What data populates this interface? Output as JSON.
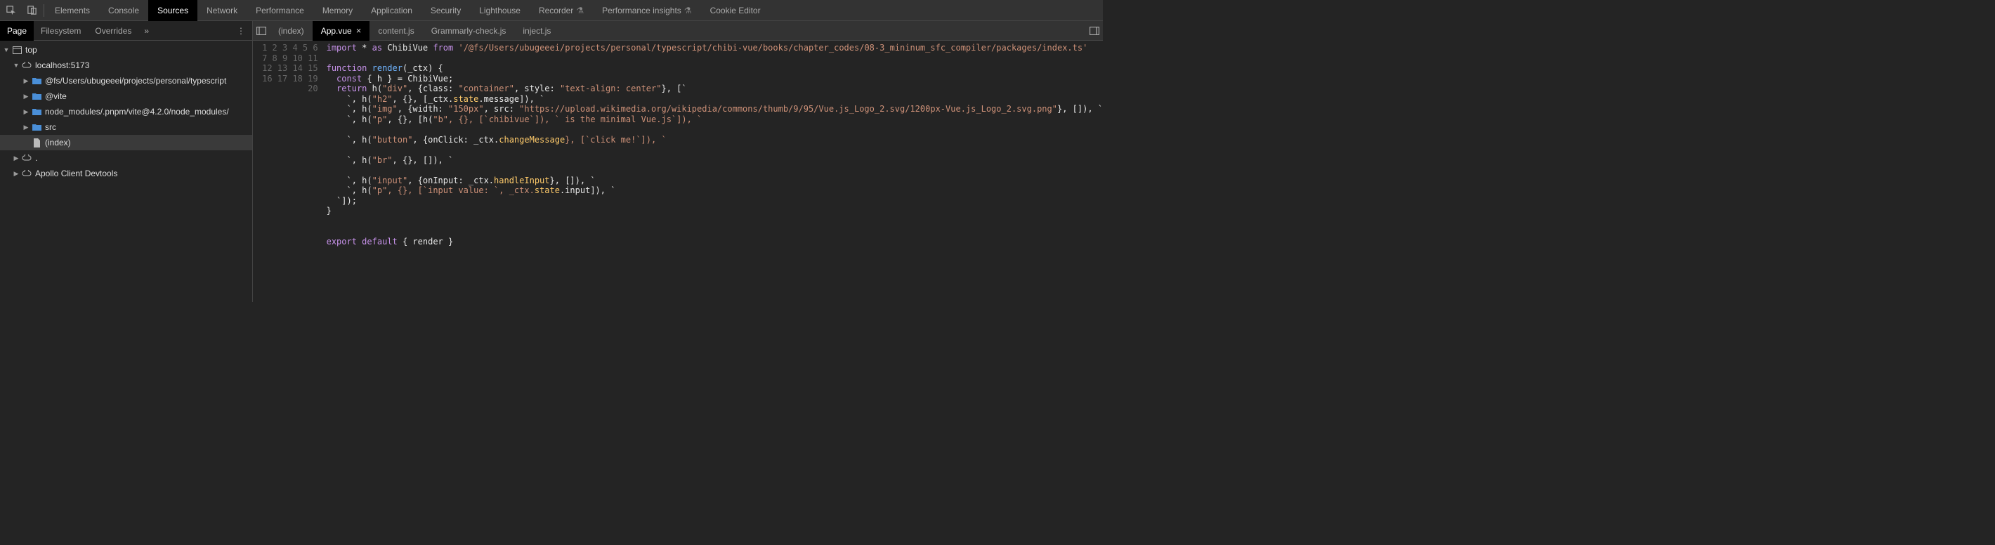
{
  "topTabs": {
    "elements": "Elements",
    "console": "Console",
    "sources": "Sources",
    "network": "Network",
    "performance": "Performance",
    "memory": "Memory",
    "application": "Application",
    "security": "Security",
    "lighthouse": "Lighthouse",
    "recorder": "Recorder",
    "perfInsights": "Performance insights",
    "cookieEditor": "Cookie Editor"
  },
  "subTabs": {
    "page": "Page",
    "filesystem": "Filesystem",
    "overrides": "Overrides"
  },
  "tree": {
    "top": "top",
    "localhost": "localhost:5173",
    "fs": "@fs/Users/ubugeeei/projects/personal/typescript",
    "vite": "@vite",
    "node_modules": "node_modules/.pnpm/vite@4.2.0/node_modules/",
    "src": "src",
    "index": "(index)",
    "dot": ".",
    "apollo": "Apollo Client Devtools"
  },
  "fileTabs": {
    "index": "(index)",
    "app": "App.vue",
    "content": "content.js",
    "grammarly": "Grammarly-check.js",
    "inject": "inject.js"
  },
  "code": {
    "line1_import": "import",
    "line1_star": " * ",
    "line1_as": "as",
    "line1_chibi": " ChibiVue ",
    "line1_from": "from",
    "line1_path": " '/@fs/Users/ubugeeei/projects/personal/typescript/chibi-vue/books/chapter_codes/08-3_mininum_sfc_compiler/packages/index.ts'",
    "line3_function": "function",
    "line3_render": " render",
    "line3_sig": "(_ctx) {",
    "line4_const": "  const",
    "line4_h": " { h } = ChibiVue;",
    "line5_return": "  return",
    "line5_hdiv": " h(",
    "line5_div": "\"div\"",
    "line5_rest": ", {class: ",
    "line5_container": "\"container\"",
    "line5_style": ", style: ",
    "line5_textalign": "\"text-align: center\"",
    "line5_end": "}, [`",
    "line6_pre": "    `, h(",
    "line6_h2": "\"h2\"",
    "line6_mid": ", {}, [_ctx.",
    "line6_state": "state",
    "line6_msg": ".message",
    "line6_end": "]), `",
    "line7_pre": "    `, h(",
    "line7_img": "\"img\"",
    "line7_width": ", {width: ",
    "line7_150": "\"150px\"",
    "line7_src": ", src: ",
    "line7_url": "\"https://upload.wikimedia.org/wikipedia/commons/thumb/9/95/Vue.js_Logo_2.svg/1200px-Vue.js_Logo_2.svg.png\"",
    "line7_end": "}, []), `",
    "line8_pre": "    `, h(",
    "line8_p": "\"p\"",
    "line8_mid": ", {}, [h(",
    "line8_b": "\"b\"",
    "line8_chibi": ", {}, [`chibivue`]), ` is the minimal Vue.js`]), `",
    "line10_pre": "    `, h(",
    "line10_btn": "\"button\"",
    "line10_onclick": ", {onClick: _ctx.",
    "line10_change": "changeMessage",
    "line10_end": "}, [`click me!`]), `",
    "line12_pre": "    `, h(",
    "line12_br": "\"br\"",
    "line12_end": ", {}, []), `",
    "line14_pre": "    `, h(",
    "line14_input": "\"input\"",
    "line14_oninput": ", {onInput: _ctx.",
    "line14_handle": "handleInput",
    "line14_end": "}, []), `",
    "line15_pre": "    `, h(",
    "line15_p": "\"p\"",
    "line15_mid": ", {}, [`input value: `, _ctx.",
    "line15_state": "state",
    "line15_input": ".input",
    "line15_end": "]), `",
    "line16": "  `]);",
    "line17": "}",
    "line20_export": "export",
    "line20_default": " default",
    "line20_rest": " { render }"
  }
}
